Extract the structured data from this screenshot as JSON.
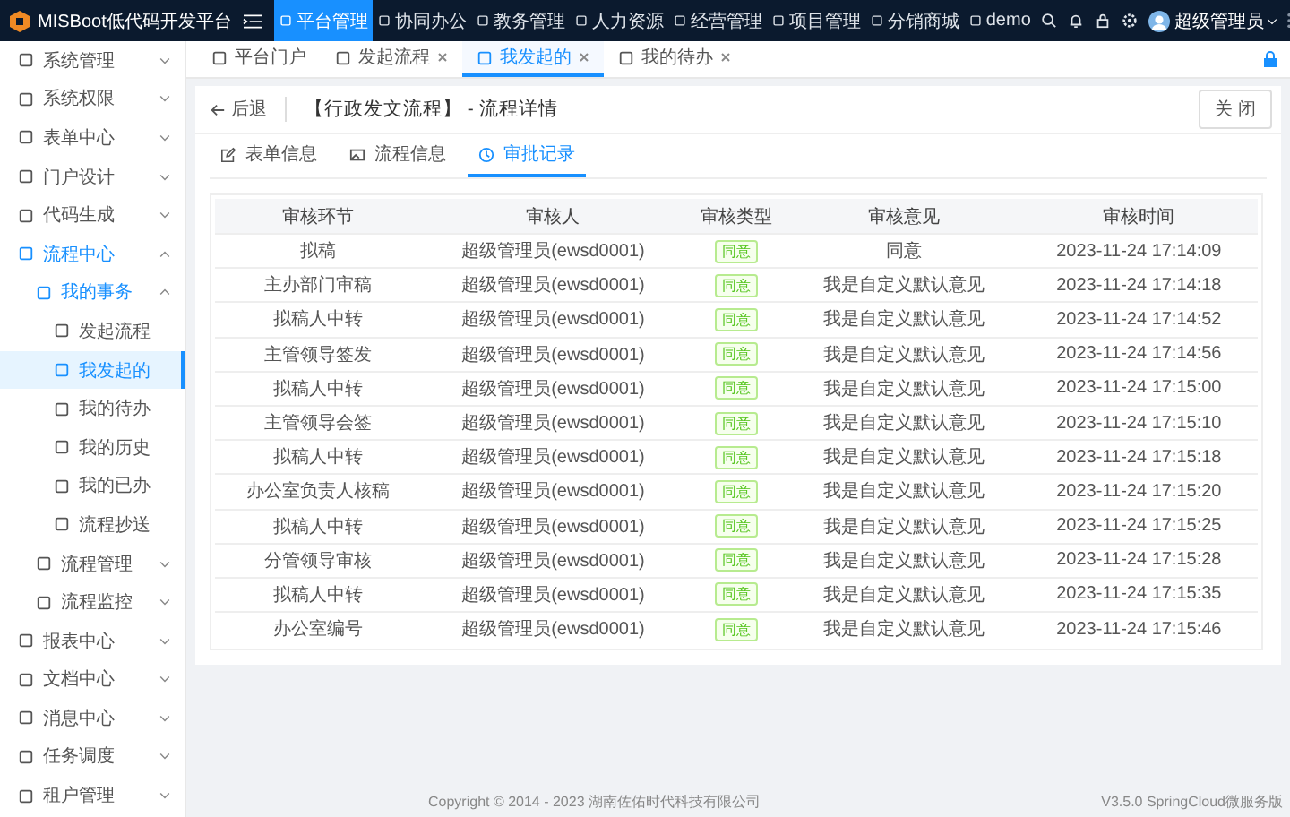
{
  "app": {
    "title": "MISBoot低代码开发平台"
  },
  "top_nav": [
    {
      "label": "平台管理",
      "selected": true
    },
    {
      "label": "协同办公",
      "selected": false
    },
    {
      "label": "教务管理",
      "selected": false
    },
    {
      "label": "人力资源",
      "selected": false
    },
    {
      "label": "经营管理",
      "selected": false
    },
    {
      "label": "项目管理",
      "selected": false
    },
    {
      "label": "分销商城",
      "selected": false
    },
    {
      "label": "demo",
      "selected": false
    }
  ],
  "user": {
    "name": "超级管理员"
  },
  "sidebar": {
    "items": [
      {
        "label": "系统管理",
        "selected": false,
        "expanded": false
      },
      {
        "label": "系统权限",
        "selected": false,
        "expanded": false
      },
      {
        "label": "表单中心",
        "selected": false,
        "expanded": false
      },
      {
        "label": "门户设计",
        "selected": false,
        "expanded": false
      },
      {
        "label": "代码生成",
        "selected": false,
        "expanded": false
      },
      {
        "label": "流程中心",
        "selected": false,
        "expanded": true,
        "children": [
          {
            "label": "我的事务",
            "selected": false,
            "expanded": true,
            "children": [
              {
                "label": "发起流程",
                "selected": false
              },
              {
                "label": "我发起的",
                "selected": true
              },
              {
                "label": "我的待办",
                "selected": false
              },
              {
                "label": "我的历史",
                "selected": false
              },
              {
                "label": "我的已办",
                "selected": false
              },
              {
                "label": "流程抄送",
                "selected": false
              }
            ]
          },
          {
            "label": "流程管理",
            "selected": false,
            "expanded": false
          },
          {
            "label": "流程监控",
            "selected": false,
            "expanded": false
          }
        ]
      },
      {
        "label": "报表中心",
        "selected": false,
        "expanded": false
      },
      {
        "label": "文档中心",
        "selected": false,
        "expanded": false
      },
      {
        "label": "消息中心",
        "selected": false,
        "expanded": false
      },
      {
        "label": "任务调度",
        "selected": false,
        "expanded": false
      },
      {
        "label": "租户管理",
        "selected": false,
        "expanded": false
      }
    ]
  },
  "page_tabs": [
    {
      "label": "平台门户",
      "selected": false,
      "closable": false
    },
    {
      "label": "发起流程",
      "selected": false,
      "closable": true
    },
    {
      "label": "我发起的",
      "selected": true,
      "closable": true
    },
    {
      "label": "我的待办",
      "selected": false,
      "closable": true
    }
  ],
  "detail": {
    "back": "后退",
    "title": "【行政发文流程】 - 流程详情",
    "close_button": "关 闭",
    "tabs": [
      {
        "label": "表单信息",
        "selected": false
      },
      {
        "label": "流程信息",
        "selected": false
      },
      {
        "label": "审批记录",
        "selected": true
      }
    ],
    "table": {
      "columns": [
        "审核环节",
        "审核人",
        "审核类型",
        "审核意见",
        "审核时间"
      ],
      "rows": [
        [
          "拟稿",
          "超级管理员(ewsd0001)",
          "同意",
          "同意",
          "2023-11-24 17:14:09"
        ],
        [
          "主办部门审稿",
          "超级管理员(ewsd0001)",
          "同意",
          "我是自定义默认意见",
          "2023-11-24 17:14:18"
        ],
        [
          "拟稿人中转",
          "超级管理员(ewsd0001)",
          "同意",
          "我是自定义默认意见",
          "2023-11-24 17:14:52"
        ],
        [
          "主管领导签发",
          "超级管理员(ewsd0001)",
          "同意",
          "我是自定义默认意见",
          "2023-11-24 17:14:56"
        ],
        [
          "拟稿人中转",
          "超级管理员(ewsd0001)",
          "同意",
          "我是自定义默认意见",
          "2023-11-24 17:15:00"
        ],
        [
          "主管领导会签",
          "超级管理员(ewsd0001)",
          "同意",
          "我是自定义默认意见",
          "2023-11-24 17:15:10"
        ],
        [
          "拟稿人中转",
          "超级管理员(ewsd0001)",
          "同意",
          "我是自定义默认意见",
          "2023-11-24 17:15:18"
        ],
        [
          "办公室负责人核稿",
          "超级管理员(ewsd0001)",
          "同意",
          "我是自定义默认意见",
          "2023-11-24 17:15:20"
        ],
        [
          "拟稿人中转",
          "超级管理员(ewsd0001)",
          "同意",
          "我是自定义默认意见",
          "2023-11-24 17:15:25"
        ],
        [
          "分管领导审核",
          "超级管理员(ewsd0001)",
          "同意",
          "我是自定义默认意见",
          "2023-11-24 17:15:28"
        ],
        [
          "拟稿人中转",
          "超级管理员(ewsd0001)",
          "同意",
          "我是自定义默认意见",
          "2023-11-24 17:15:35"
        ],
        [
          "办公室编号",
          "超级管理员(ewsd0001)",
          "同意",
          "我是自定义默认意见",
          "2023-11-24 17:15:46"
        ]
      ]
    }
  },
  "footer": {
    "copyright": "Copyright © 2014 - 2023 湖南佐佑时代科技有限公司",
    "version": "V3.5.0 SpringCloud微服务版"
  }
}
